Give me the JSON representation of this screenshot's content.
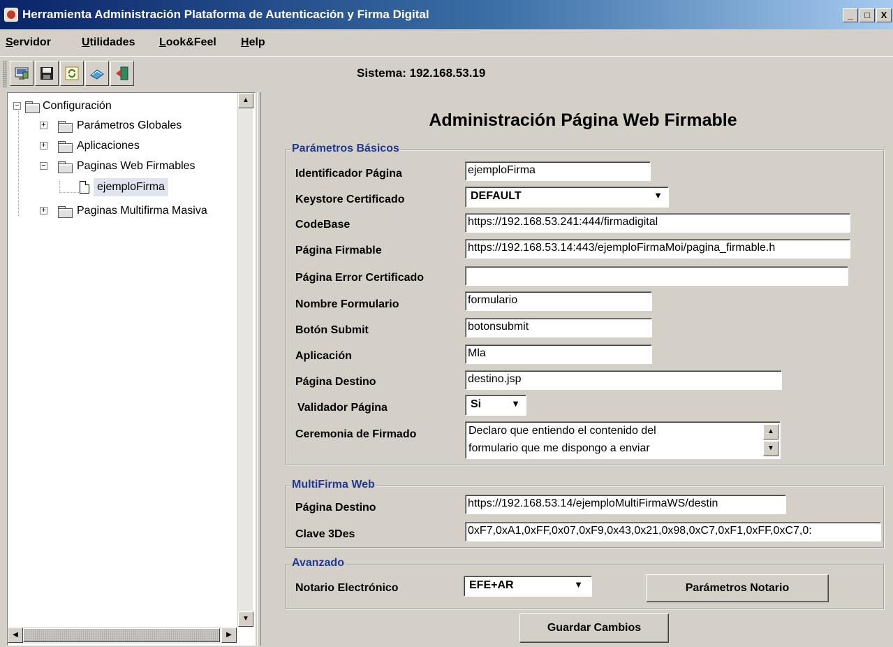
{
  "window": {
    "title": "Herramienta Administración Plataforma de Autenticación y Firma Digital",
    "minimize": "_",
    "maximize": "□",
    "close": "X"
  },
  "menubar": {
    "items": [
      {
        "first": "S",
        "rest": "ervidor"
      },
      {
        "first": "U",
        "rest": "tilidades"
      },
      {
        "first": "L",
        "rest": "ook&Feel"
      },
      {
        "first": "H",
        "rest": "elp"
      }
    ]
  },
  "toolbar": {
    "icons": [
      "server-config-icon",
      "save-icon",
      "refresh-icon",
      "book-icon",
      "exit-door-icon"
    ],
    "system_label": "Sistema:",
    "system_value": "192.168.53.19"
  },
  "tree": {
    "root": "Configuración",
    "nodes": [
      "Parámetros Globales",
      "Aplicaciones",
      "Paginas Web Firmables",
      "ejemploFirma",
      "Paginas Multifirma Masiva"
    ]
  },
  "main": {
    "title": "Administración Página Web Firmable",
    "basic": {
      "legend": "Parámetros Básicos",
      "labels": {
        "identificador": "Identificador Página",
        "keystore": "Keystore Certificado",
        "codebase": "CodeBase",
        "firmable": "Página Firmable",
        "error_cert": "Página Error Certificado",
        "formulario": "Nombre Formulario",
        "submit": "Botón Submit",
        "aplicacion": "Aplicación",
        "destino": "Página Destino",
        "validador": "Validador Página",
        "ceremonia": "Ceremonia de Firmado"
      },
      "values": {
        "identificador": "ejemploFirma",
        "keystore": "DEFAULT",
        "codebase": "https://192.168.53.241:444/firmadigital",
        "firmable": "https://192.168.53.14:443/ejemploFirmaMoi/pagina_firmable.h",
        "error_cert": "",
        "formulario": "formulario",
        "submit": "botonsubmit",
        "aplicacion": "Mla",
        "destino": "destino.jsp",
        "validador": "Si",
        "ceremonia_line1": "Declaro que entiendo el contenido del",
        "ceremonia_line2": "formulario que me dispongo a enviar"
      }
    },
    "multifirma": {
      "legend": "MultiFirma Web",
      "destino_label": "Página Destino",
      "destino_value": "https://192.168.53.14/ejemploMultiFirmaWS/destin",
      "clave_label": "Clave 3Des",
      "clave_value": "0xF7,0xA1,0xFF,0x07,0xF9,0x43,0x21,0x98,0xC7,0xF1,0xFF,0xC7,0:"
    },
    "avanzado": {
      "legend": "Avanzado",
      "notario_label": "Notario Electrónico",
      "notario_value": "EFE+AR",
      "params_button": "Parámetros Notario"
    },
    "save_button": "Guardar Cambios"
  }
}
